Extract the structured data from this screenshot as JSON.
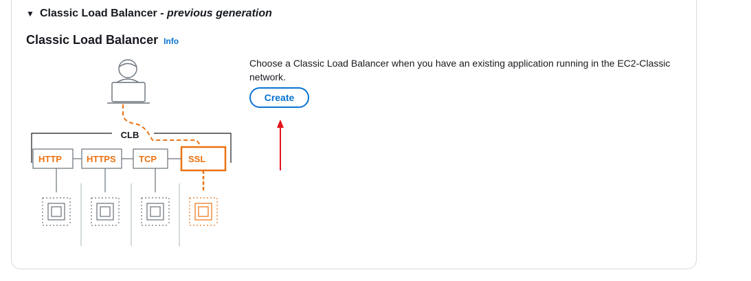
{
  "section": {
    "title": "Classic Load Balancer",
    "separator": " - ",
    "subtitle": "previous generation"
  },
  "panel": {
    "title": "Classic Load Balancer",
    "info_label": "Info",
    "description": "Choose a Classic Load Balancer when you have an existing application running in the EC2-Classic network.",
    "create_label": "Create"
  },
  "diagram": {
    "lb_label": "CLB",
    "listeners": [
      "HTTP",
      "HTTPS",
      "TCP",
      "SSL"
    ],
    "highlighted_listener": "SSL"
  },
  "colors": {
    "accent": "#0972d3",
    "highlight": "#ec7211",
    "annotation_arrow": "#e3141b"
  }
}
